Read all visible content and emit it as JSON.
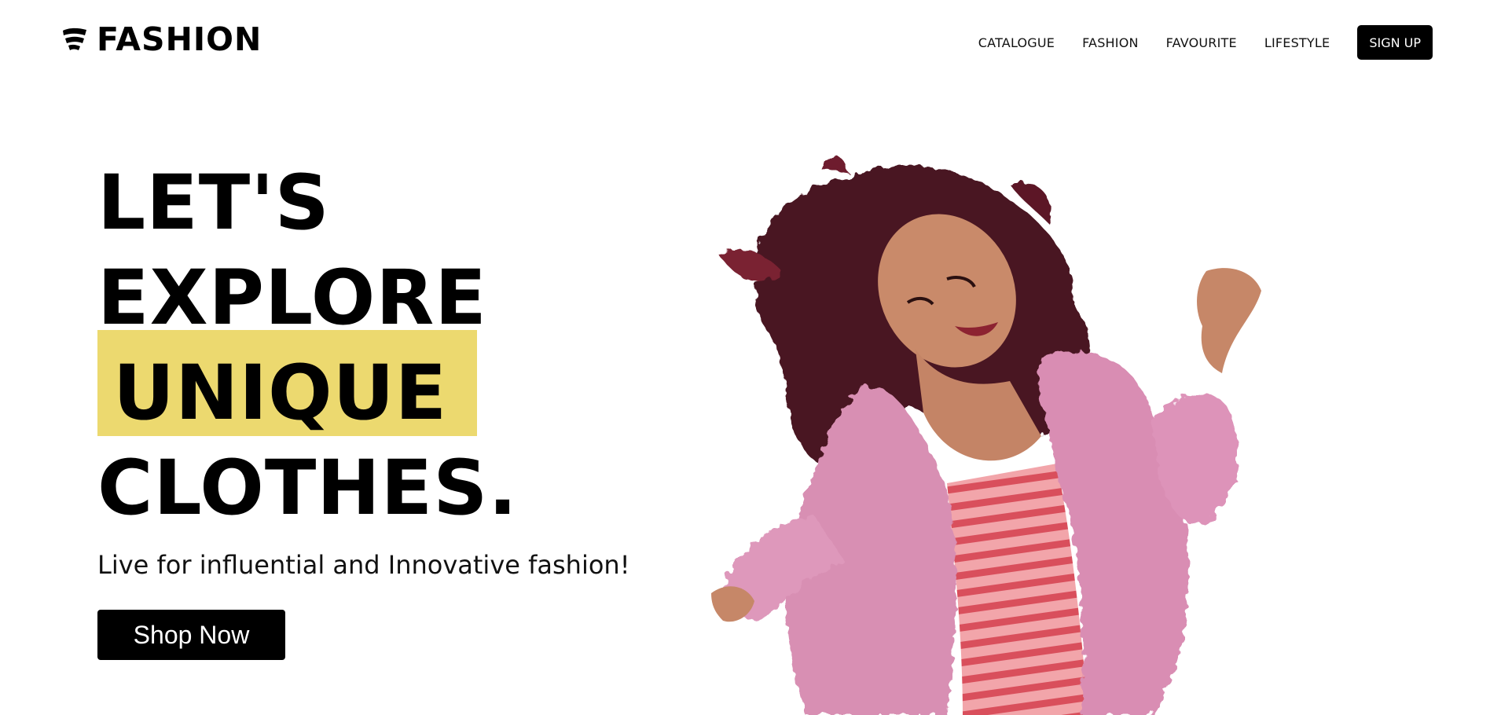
{
  "brand": {
    "name": "FASHION",
    "logo_icon": "flag-wave-icon"
  },
  "nav": {
    "links": [
      "CATALOGUE",
      "FASHION",
      "FAVOURITE",
      "LIFESTYLE"
    ],
    "signup_label": "SIGN UP"
  },
  "hero": {
    "headline": [
      "LET'S",
      "EXPLORE",
      "UNIQUE",
      "CLOTHES."
    ],
    "highlight_color": "#ecd96f",
    "tagline": "Live for influential and Innovative fashion!",
    "cta_label": "Shop Now",
    "image": "woman-in-pink-fur-coat-photo"
  },
  "colors": {
    "primary": "#000000",
    "background": "#ffffff",
    "accent": "#ecd96f"
  }
}
